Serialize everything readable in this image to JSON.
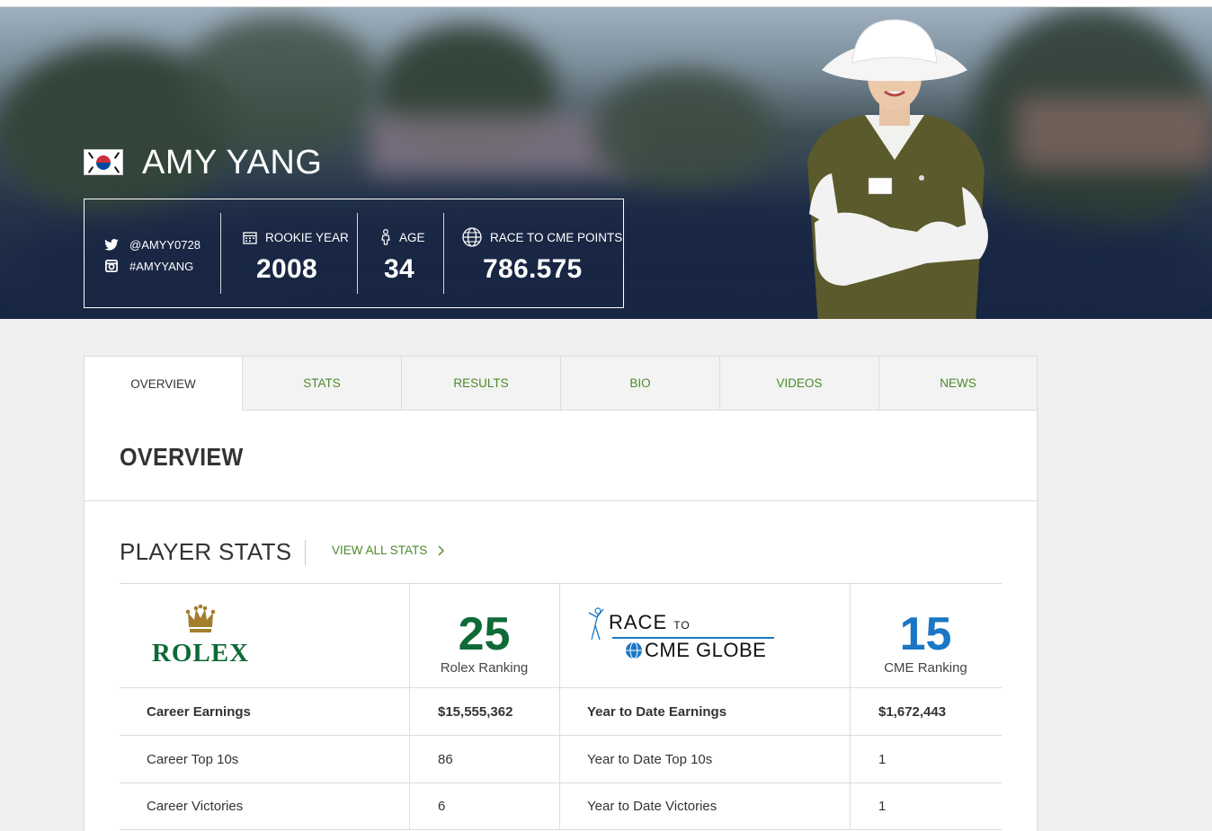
{
  "player": {
    "name": "AMY YANG",
    "twitter": "@AMYY0728",
    "instagram": "#AMYYANG",
    "stats": [
      {
        "label": "ROOKIE YEAR",
        "value": "2008"
      },
      {
        "label": "AGE",
        "value": "34"
      },
      {
        "label": "RACE TO CME POINTS",
        "value": "786.575"
      }
    ]
  },
  "tabs": [
    "OVERVIEW",
    "STATS",
    "RESULTS",
    "BIO",
    "VIDEOS",
    "NEWS"
  ],
  "overview": {
    "title": "OVERVIEW",
    "player_stats_title": "PLAYER STATS",
    "view_all": "VIEW ALL STATS"
  },
  "rankings": {
    "rolex_logo": "ROLEX",
    "rolex_value": "25",
    "rolex_label": "Rolex Ranking",
    "cme_logo_line1": "RACE",
    "cme_logo_to": "TO",
    "cme_logo_line2": "CME GLOBE",
    "cme_value": "15",
    "cme_label": "CME Ranking"
  },
  "table": [
    {
      "l1": "Career Earnings",
      "v1": "$15,555,362",
      "l2": "Year to Date Earnings",
      "v2": "$1,672,443",
      "bold": true
    },
    {
      "l1": "Career Top 10s",
      "v1": "86",
      "l2": "Year to Date Top 10s",
      "v2": "1",
      "bold": false
    },
    {
      "l1": "Career Victories",
      "v1": "6",
      "l2": "Year to Date Victories",
      "v2": "1",
      "bold": false
    }
  ],
  "colors": {
    "green": "#4b8a2a",
    "rolex_green": "#0e6a36",
    "cme_blue": "#1a77c6",
    "hero_navy": "#172544"
  }
}
